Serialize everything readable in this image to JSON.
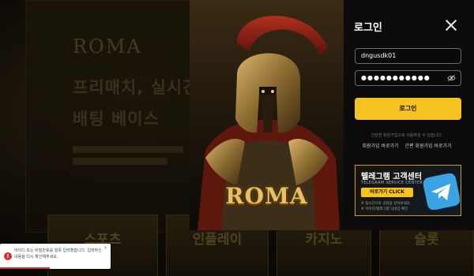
{
  "background": {
    "brand": "ROMA",
    "lines": [
      "프리매치, 실시간",
      "배팅 베이스"
    ],
    "tiles": [
      "스포츠",
      "인플레이",
      "카지노",
      "슬롯"
    ]
  },
  "modal": {
    "title": "로그인",
    "hero_logo": "ROMA",
    "username_value": "dngusdk01",
    "password_value": "●●●●●●●●●●●",
    "login_label": "로그인",
    "notice": "간단한 회원가입으로 이용하실 수 있습니다.",
    "links": [
      "회원가입 바로가기",
      "간편 회원가입 바로가기"
    ],
    "telegram": {
      "title": "텔레그램 고객센터",
      "subtitle": "TELEGRAM SERVICE CENTER",
      "button": "바로가기 CLICK",
      "notes": [
        "# 실시간으로 상담을 받아보세요",
        "# 아이디/텔레그램 닉네임 확인"
      ]
    }
  },
  "toast": {
    "message": "아이디 또는 비밀번호를 잘못 입력했습니다. 입력하신 내용을 다시 확인해주세요.",
    "close": "×",
    "progress": 0.45
  },
  "colors": {
    "accent": "#f5c21f",
    "error": "#e02b2b",
    "modal_bg": "#0b0b0b"
  },
  "icons": [
    "close-icon",
    "eye-off-icon",
    "telegram-icon",
    "error-icon"
  ]
}
